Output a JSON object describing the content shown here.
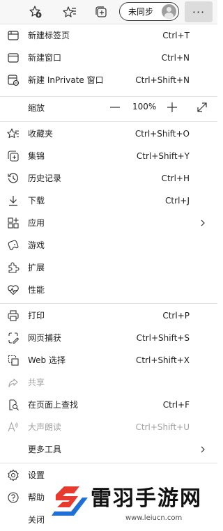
{
  "toolbar": {
    "profile_label": "未同步",
    "more_label": "···",
    "icons": [
      "favorites-add-icon",
      "favorites-icon",
      "collections-icon",
      "avatar",
      "more-icon"
    ]
  },
  "menu": {
    "new_tab": {
      "label": "新建标签页",
      "shortcut": "Ctrl+T"
    },
    "new_window": {
      "label": "新建窗口",
      "shortcut": "Ctrl+N"
    },
    "new_inprivate": {
      "label": "新建 InPrivate 窗口",
      "shortcut": "Ctrl+Shift+N"
    },
    "zoom": {
      "label": "缩放",
      "minus": "—",
      "value": "100%",
      "plus": "+"
    },
    "favorites": {
      "label": "收藏夹",
      "shortcut": "Ctrl+Shift+O"
    },
    "collections": {
      "label": "集锦",
      "shortcut": "Ctrl+Shift+Y"
    },
    "history": {
      "label": "历史记录",
      "shortcut": "Ctrl+H"
    },
    "downloads": {
      "label": "下载",
      "shortcut": "Ctrl+J"
    },
    "apps": {
      "label": "应用"
    },
    "games": {
      "label": "游戏"
    },
    "extensions": {
      "label": "扩展"
    },
    "performance": {
      "label": "性能"
    },
    "print": {
      "label": "打印",
      "shortcut": "Ctrl+P"
    },
    "web_capture": {
      "label": "网页捕获",
      "shortcut": "Ctrl+Shift+S"
    },
    "web_select": {
      "label": "Web 选择",
      "shortcut": "Ctrl+Shift+X"
    },
    "share": {
      "label": "共享"
    },
    "find": {
      "label": "在页面上查找",
      "shortcut": "Ctrl+F"
    },
    "read_aloud": {
      "label": "大声朗读",
      "shortcut": "Ctrl+Shift+U"
    },
    "more_tools": {
      "label": "更多工具"
    },
    "settings": {
      "label": "设置"
    },
    "help": {
      "label": "帮助"
    },
    "close": {
      "label": "关闭"
    }
  },
  "watermark": {
    "title": "雷羽手游网",
    "url": "www.leiucn.com"
  },
  "colors": {
    "accent_disabled": "#a3a3a3",
    "toolbar_bg": "#f7f7f7",
    "more_bg": "#dcdcdc",
    "watermark_red": "#e63b2e",
    "watermark_blue": "#1f6fd6"
  }
}
